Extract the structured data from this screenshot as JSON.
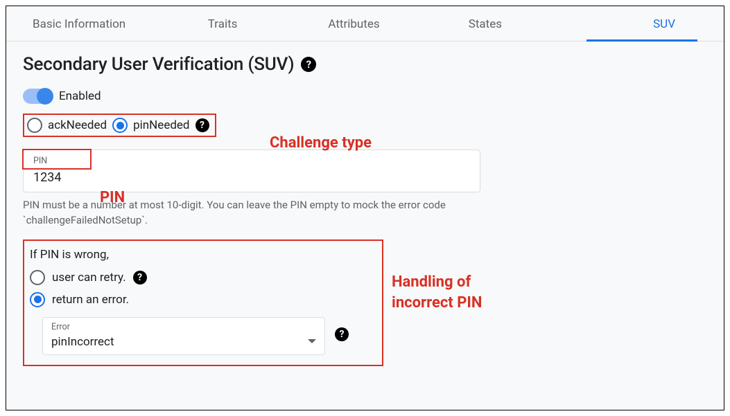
{
  "tabs": [
    {
      "label": "Basic Information",
      "active": false
    },
    {
      "label": "Traits",
      "active": false
    },
    {
      "label": "Attributes",
      "active": false
    },
    {
      "label": "States",
      "active": false
    },
    {
      "label": "SUV",
      "active": true
    }
  ],
  "page": {
    "title": "Secondary User Verification (SUV)"
  },
  "toggle": {
    "label": "Enabled",
    "value": true
  },
  "challenge": {
    "options": {
      "ack": "ackNeeded",
      "pin": "pinNeeded"
    },
    "selected": "pinNeeded"
  },
  "pin": {
    "label": "PIN",
    "value": "1234",
    "helper": "PIN must be a number at most 10-digit. You can leave the PIN empty to mock the error code `challengeFailedNotSetup`."
  },
  "wrongPin": {
    "prompt": "If PIN is wrong,",
    "options": {
      "retry": "user can retry.",
      "error": "return an error."
    },
    "selected": "error",
    "errorSelect": {
      "label": "Error",
      "value": "pinIncorrect"
    }
  },
  "annotations": {
    "challenge": "Challenge type",
    "pin": "PIN",
    "handling": "Handling of\nincorrect PIN"
  },
  "colors": {
    "accent": "#1a73e8",
    "annotation": "#d93025"
  }
}
